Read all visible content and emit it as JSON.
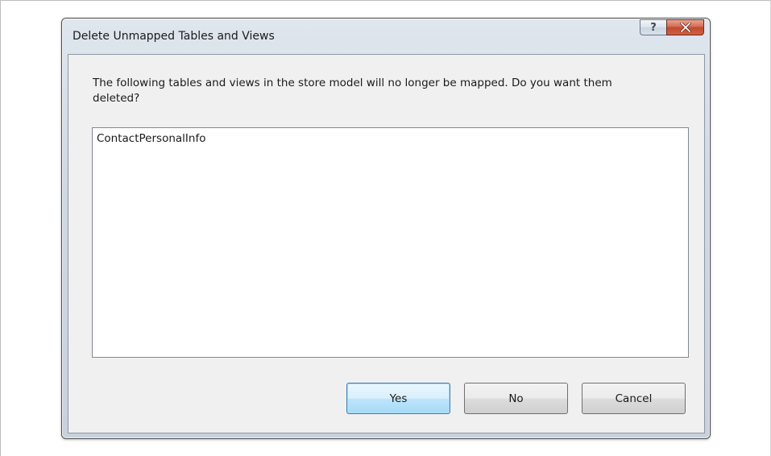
{
  "dialog": {
    "title": "Delete Unmapped Tables and Views",
    "help_label": "?",
    "message": "The following tables and views in the store model will no longer be mapped.  Do you want them deleted?",
    "items": [
      "ContactPersonalInfo"
    ],
    "buttons": {
      "yes": "Yes",
      "no": "No",
      "cancel": "Cancel"
    }
  },
  "colors": {
    "window_frame": "#cfd9e3",
    "close_button": "#c24a30",
    "default_button_border": "#3c7fb1",
    "client_background": "#f0f0f0"
  },
  "icons": {
    "help": "question-mark-icon",
    "close": "close-icon"
  }
}
